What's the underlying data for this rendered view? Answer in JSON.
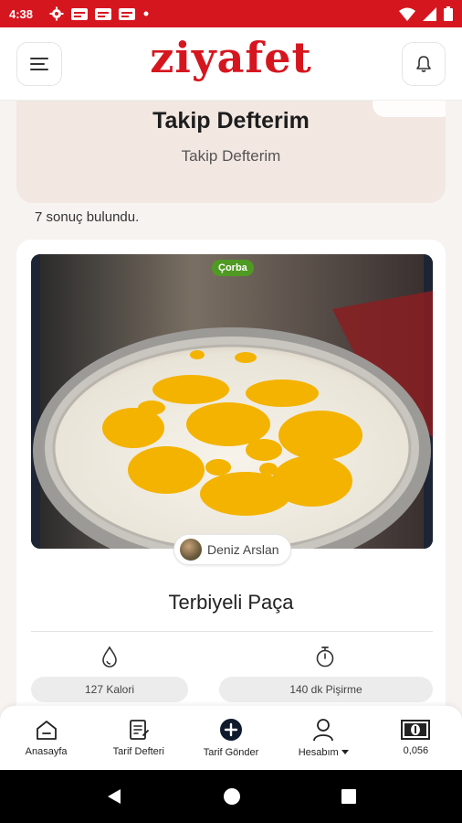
{
  "status_bar": {
    "time": "4:38"
  },
  "header": {
    "logo": "ziyafet"
  },
  "hero": {
    "title": "Takip Defterim",
    "subtitle": "Takip Defterim"
  },
  "results": {
    "count_text": "7 sonuç bulundu."
  },
  "recipe": {
    "category": "Çorba",
    "author": "Deniz Arslan",
    "title": "Terbiyeli Paça",
    "calories": "127 Kalori",
    "cook_time": "140 dk Pişirme"
  },
  "bottom_nav": {
    "items": [
      {
        "label": "Anasayfa",
        "icon": "home-icon"
      },
      {
        "label": "Tarif Defteri",
        "icon": "notebook-icon"
      },
      {
        "label": "Tarif Gönder",
        "icon": "plus-circle-icon"
      },
      {
        "label": "Hesabım",
        "icon": "user-icon"
      },
      {
        "label": "0,056",
        "icon": "banknote-icon"
      }
    ]
  },
  "colors": {
    "brand": "#d6161f",
    "badge": "#4f9a22",
    "hero_bg": "#f2e7e1"
  }
}
